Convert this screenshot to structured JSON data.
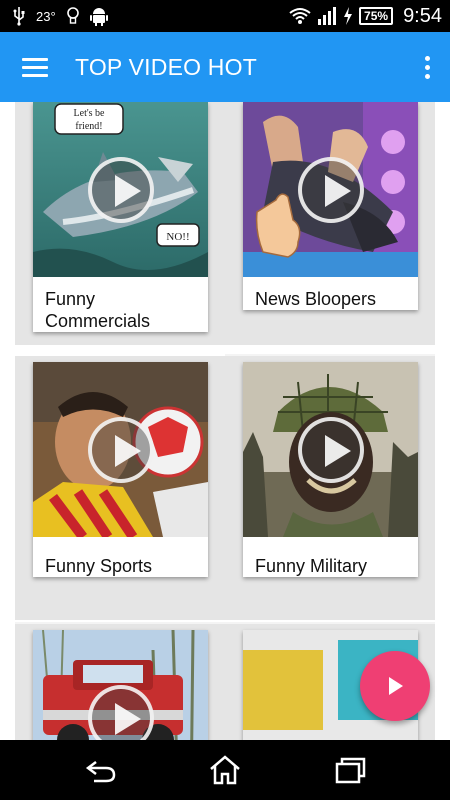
{
  "status_bar": {
    "temperature": "23°",
    "battery": "75%",
    "time": "9:54",
    "icons": [
      "usb-icon",
      "bulb-icon",
      "android-icon",
      "wifi-icon",
      "signal-icon",
      "charging-icon",
      "battery-icon"
    ]
  },
  "app_bar": {
    "title": "TOP VIDEO HOT",
    "menu_icon": "hamburger-menu-icon",
    "overflow_icon": "more-vert-icon",
    "color": "#2196f3"
  },
  "thumbnails": {
    "cartoon_speech_top": "Let's be\nfriend!",
    "cartoon_speech_bottom": "NO!!"
  },
  "videos": [
    {
      "title": "Funny Commercials"
    },
    {
      "title": "News Bloopers"
    },
    {
      "title": "Funny Sports"
    },
    {
      "title": "Funny Military"
    },
    {
      "title": ""
    },
    {
      "title": ""
    }
  ],
  "fab": {
    "icon": "play-icon",
    "color": "#ef3f73"
  },
  "nav_bar": {
    "icons": [
      "back-icon",
      "home-icon",
      "recent-apps-icon"
    ]
  }
}
